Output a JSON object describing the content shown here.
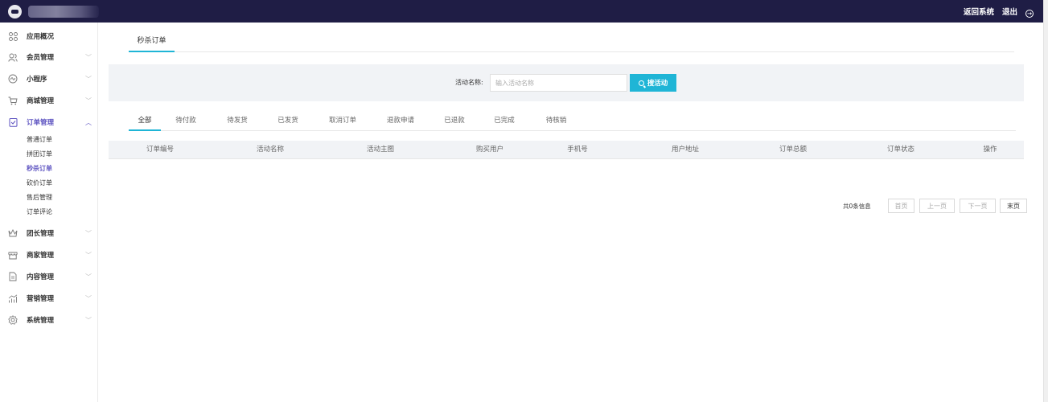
{
  "header": {
    "back_label": "返回系统",
    "logout_label": "退出"
  },
  "sidebar": {
    "items": [
      {
        "label": "应用概况",
        "icon": "grid-icon"
      },
      {
        "label": "会员管理",
        "icon": "users-icon"
      },
      {
        "label": "小程序",
        "icon": "miniprogram-icon"
      },
      {
        "label": "商城管理",
        "icon": "cart-icon"
      },
      {
        "label": "订单管理",
        "icon": "order-icon"
      },
      {
        "label": "团长管理",
        "icon": "crown-icon"
      },
      {
        "label": "商家管理",
        "icon": "shop-icon"
      },
      {
        "label": "内容管理",
        "icon": "document-icon"
      },
      {
        "label": "营销管理",
        "icon": "chart-icon"
      },
      {
        "label": "系统管理",
        "icon": "settings-icon"
      }
    ],
    "order_sub_items": [
      "普通订单",
      "拼团订单",
      "秒杀订单",
      "砍价订单",
      "售后管理",
      "订单评论"
    ]
  },
  "main": {
    "tab_label": "秒杀订单",
    "search": {
      "label": "活动名称:",
      "placeholder": "输入活动名称",
      "button_label": "搜活动"
    },
    "status_tabs": [
      "全部",
      "待付款",
      "待发货",
      "已发货",
      "取消订单",
      "退款申请",
      "已退款",
      "已完成",
      "待核销"
    ],
    "table_columns": [
      "订单编号",
      "活动名称",
      "活动主图",
      "购买用户",
      "手机号",
      "用户地址",
      "订单总额",
      "订单状态",
      "操作"
    ],
    "pagination": {
      "info": "共0条信息",
      "first": "首页",
      "prev": "上一页",
      "next": "下一页",
      "last": "末页"
    }
  },
  "colors": {
    "topbar": "#1f1d45",
    "accent": "#1fb5d6",
    "active_nav": "#5c52c0"
  }
}
